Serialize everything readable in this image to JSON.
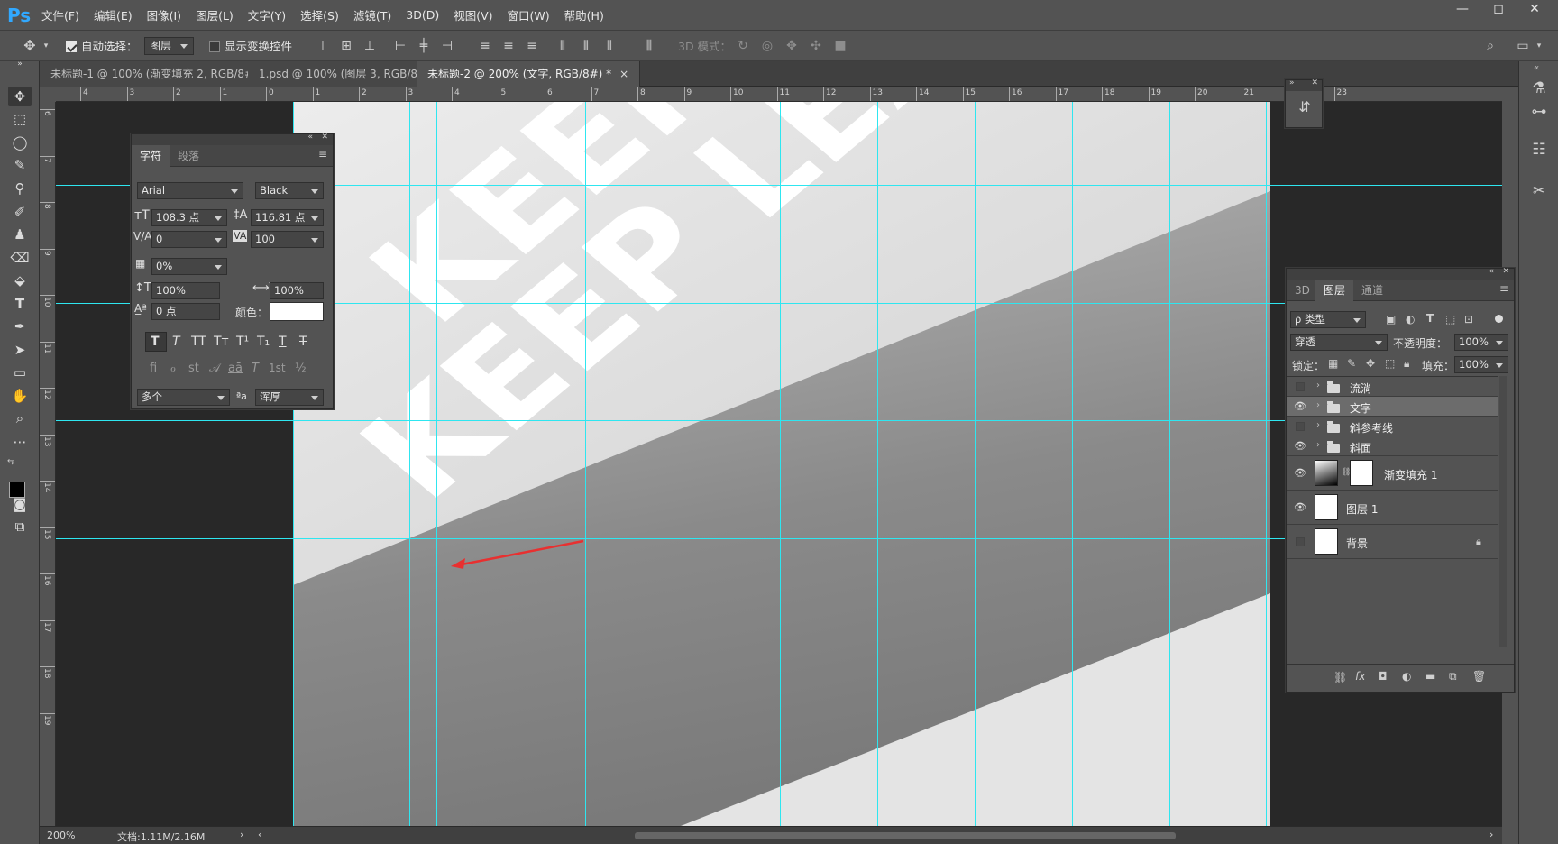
{
  "app": {
    "logo": "Ps"
  },
  "menu": [
    "文件(F)",
    "编辑(E)",
    "图像(I)",
    "图层(L)",
    "文字(Y)",
    "选择(S)",
    "滤镜(T)",
    "3D(D)",
    "视图(V)",
    "窗口(W)",
    "帮助(H)"
  ],
  "window_controls": {
    "minimize": "—",
    "restore": "◻",
    "close": "✕"
  },
  "options": {
    "auto_select_label": "自动选择：",
    "auto_select_value": "图层",
    "show_transform_label": "显示变换控件",
    "mode_3d_label": "3D 模式："
  },
  "tabs": [
    {
      "label": "未标题-1 @ 100% (渐变填充 2, RGB/8#) *",
      "close": "×"
    },
    {
      "label": "1.psd @ 100% (图层 3, RGB/8) *",
      "close": "×"
    },
    {
      "label": "未标题-2 @ 200% (文字, RGB/8#) *",
      "close": "×"
    }
  ],
  "ruler_top": [
    "4",
    "3",
    "2",
    "1",
    "0",
    "1",
    "2",
    "3",
    "4",
    "5",
    "6",
    "7",
    "8",
    "9",
    "10",
    "11",
    "12",
    "13",
    "14",
    "15",
    "16",
    "17",
    "18",
    "19",
    "20",
    "21",
    "22",
    "23"
  ],
  "ruler_left": [
    "6",
    "7",
    "8",
    "9",
    "10",
    "11",
    "12",
    "13",
    "14",
    "15",
    "16",
    "17",
    "18",
    "19"
  ],
  "canvas": {
    "text_line1": "KEEP CALM",
    "text_line2": "KEEP LEARNING"
  },
  "character_panel": {
    "tab_char": "字符",
    "tab_para": "段落",
    "font_family": "Arial",
    "font_style": "Black",
    "font_size": "108.3 点",
    "leading": "116.81 点",
    "kerning": "0",
    "tracking": "100",
    "tsume": "0%",
    "vscale": "100%",
    "hscale": "100%",
    "baseline": "0 点",
    "color_label": "颜色：",
    "language": "多个",
    "aa_label": "ªa",
    "antialias": "浑厚",
    "style_buttons": [
      "T",
      "T",
      "TT",
      "Tт",
      "T¹",
      "T₁",
      "T",
      "T"
    ],
    "ot_buttons": [
      "fi",
      "ℴ",
      "st",
      "𝒜",
      "aā",
      "T",
      "1st",
      "½"
    ]
  },
  "layers_panel": {
    "tabs": [
      "3D",
      "图层",
      "通道"
    ],
    "filter_label": "ρ 类型",
    "blend_mode": "穿透",
    "opacity_label": "不透明度：",
    "opacity": "100%",
    "lock_label": "锁定：",
    "fill_label": "填充：",
    "fill": "100%",
    "layers": [
      {
        "name": "流淌",
        "type": "group",
        "visible": false,
        "selected": false
      },
      {
        "name": "文字",
        "type": "group",
        "visible": true,
        "selected": true
      },
      {
        "name": "斜参考线",
        "type": "group",
        "visible": false,
        "selected": false
      },
      {
        "name": "斜面",
        "type": "group",
        "visible": true,
        "selected": false
      },
      {
        "name": "渐变填充 1",
        "type": "fill",
        "visible": true,
        "selected": false
      },
      {
        "name": "图层 1",
        "type": "layer",
        "visible": true,
        "selected": false
      },
      {
        "name": "背景",
        "type": "background",
        "visible": false,
        "selected": false
      }
    ],
    "footer_icons": [
      "link-icon",
      "fx-icon",
      "mask-icon",
      "adjustment-icon",
      "new-group-icon",
      "new-layer-icon",
      "trash-icon"
    ],
    "fx_label": "fx"
  },
  "status": {
    "zoom": "200%",
    "doc_info": "文档:1.11M/2.16M"
  },
  "colors": {
    "guide": "#2ee6f0",
    "canvas_text": "#ffffff",
    "arrow": "#e83030"
  }
}
